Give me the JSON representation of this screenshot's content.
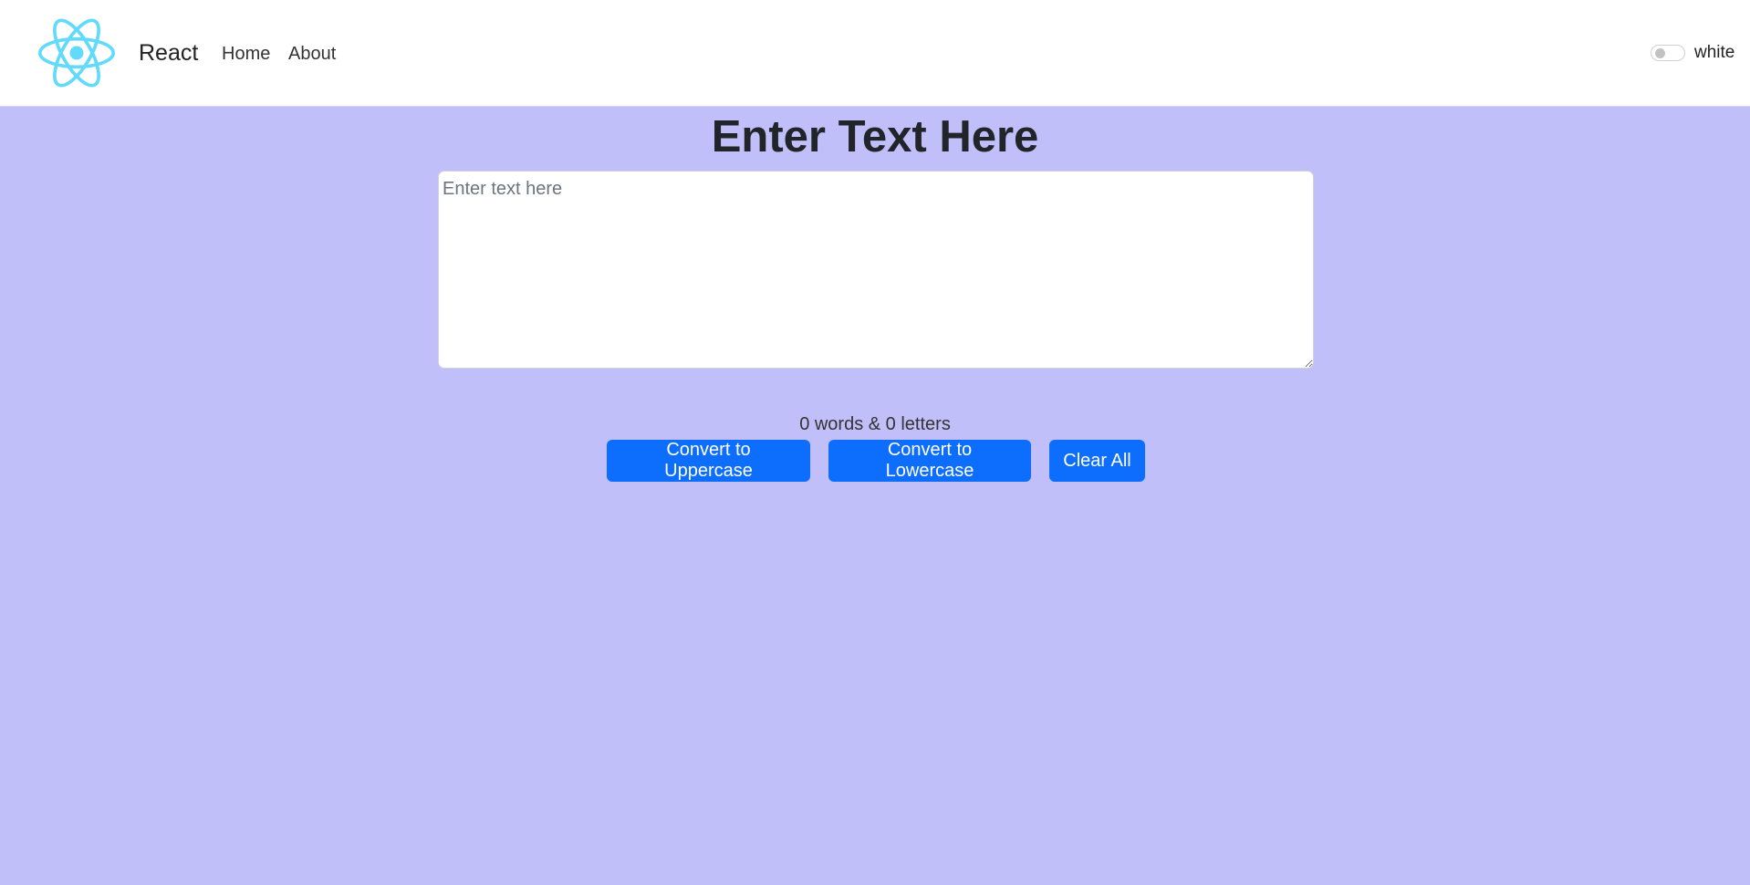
{
  "navbar": {
    "logo_icon": "react-atom-logo",
    "brand": "React",
    "links": [
      {
        "label": "Home"
      },
      {
        "label": "About"
      }
    ],
    "toggle": {
      "label": "white",
      "checked": false
    }
  },
  "main": {
    "heading": "Enter Text Here",
    "textarea": {
      "value": "",
      "placeholder": "Enter text here"
    },
    "summary": "0 words & 0 letters",
    "buttons": {
      "uppercase": "Convert to Uppercase",
      "lowercase": "Convert to Lowercase",
      "clear": "Clear All"
    }
  },
  "colors": {
    "page_background": "#c0bffa",
    "navbar_background": "#ffffff",
    "button_primary": "#0d6efd",
    "react_logo": "#61dafb"
  }
}
